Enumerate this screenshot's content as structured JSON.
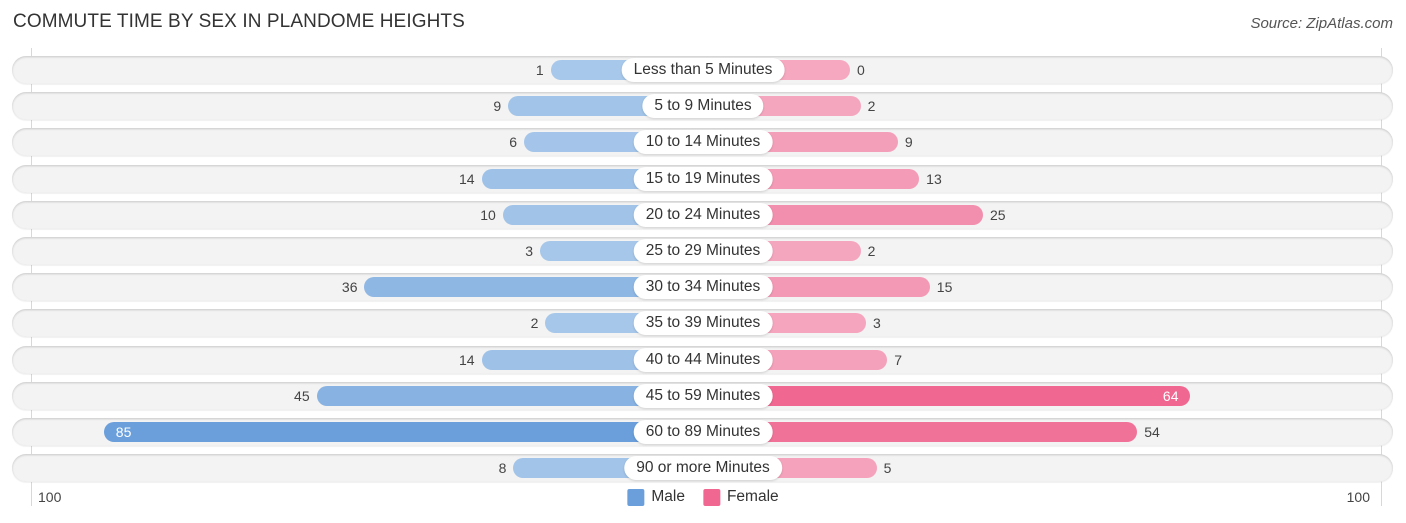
{
  "title": "COMMUTE TIME BY SEX IN PLANDOME HEIGHTS",
  "source": "Source: ZipAtlas.com",
  "colors": {
    "male": "#6a9fdb",
    "male_light": "#a8c8ea",
    "female": "#f06892",
    "female_light": "#f5a8c0"
  },
  "legend": [
    {
      "name": "Male",
      "color": "#6a9fdb"
    },
    {
      "name": "Female",
      "color": "#f06892"
    }
  ],
  "axis": {
    "left_label": "100",
    "right_label": "100"
  },
  "chart_data": {
    "type": "bar",
    "orientation": "horizontal-diverging",
    "title": "COMMUTE TIME BY SEX IN PLANDOME HEIGHTS",
    "xlabel": "",
    "ylabel": "",
    "xlim": [
      -100,
      100
    ],
    "legend_position": "bottom-center",
    "categories": [
      "Less than 5 Minutes",
      "5 to 9 Minutes",
      "10 to 14 Minutes",
      "15 to 19 Minutes",
      "20 to 24 Minutes",
      "25 to 29 Minutes",
      "30 to 34 Minutes",
      "35 to 39 Minutes",
      "40 to 44 Minutes",
      "45 to 59 Minutes",
      "60 to 89 Minutes",
      "90 or more Minutes"
    ],
    "series": [
      {
        "name": "Male",
        "side": "left",
        "values": [
          1,
          9,
          6,
          14,
          10,
          3,
          36,
          2,
          14,
          45,
          85,
          8
        ]
      },
      {
        "name": "Female",
        "side": "right",
        "values": [
          0,
          2,
          9,
          13,
          25,
          2,
          15,
          3,
          7,
          64,
          54,
          5
        ]
      }
    ]
  }
}
